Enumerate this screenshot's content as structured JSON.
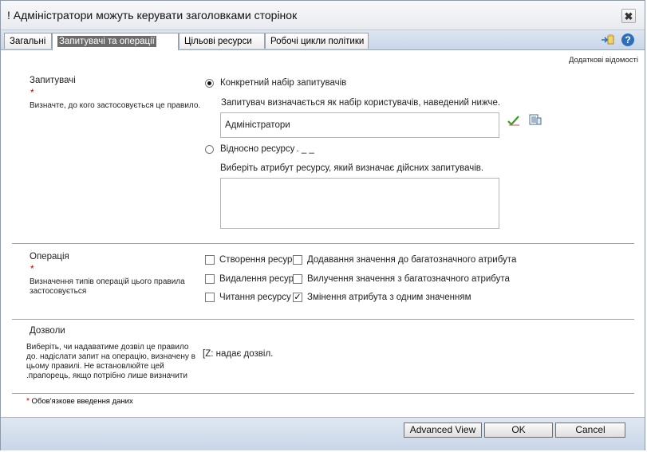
{
  "window": {
    "title": "! Адміністратори можуть керувати заголовками сторінок",
    "close_glyph": "✖"
  },
  "tabs": [
    {
      "label": "Загальні",
      "active": false
    },
    {
      "label": "Запитувачі та операції",
      "active": true
    },
    {
      "label": "Цільові ресурси",
      "active": false
    },
    {
      "label": "Робочі цикли політики",
      "active": false
    }
  ],
  "top_link": "Додаткові відомості",
  "requestors": {
    "title": "Запитувачі",
    "required_mark": "*",
    "description": "Визначте, до кого застосовується це правило.",
    "option_specific": "Конкретний набір запитувачів",
    "specific_help": "Запитувач визначається як набір користувачів, наведений нижче.",
    "specific_value": "Адміністратори",
    "option_relative": "Відносно ресурсу",
    "relative_suffix": ". _ _",
    "relative_help": "Виберіть атрибут ресурсу, який визначає дійсних запитувачів.",
    "relative_value": "",
    "selected": "specific"
  },
  "operation": {
    "title": "Операція",
    "required_mark": "*",
    "description": "Визначення типів операцій цього правила застосовується",
    "items": [
      {
        "label": "Створення ресурсу",
        "checked": false
      },
      {
        "label": "Додавання значення до багатозначного атрибута",
        "checked": false
      },
      {
        "label": "Видалення ресурсу",
        "checked": false
      },
      {
        "label": "Вилучення значення з багатозначного атрибута",
        "checked": false
      },
      {
        "label": "Читання ресурсу",
        "checked": false
      },
      {
        "label": "Змінення атрибута з одним значенням",
        "checked": true
      }
    ]
  },
  "permissions": {
    "title": "Дозволи",
    "description": "Виберіть, чи надаватиме дозвіл це правило до. надіслати запит на операцію, визначену в цьому правилі. Не встановлюйте цей .прапорець, якщо потрібно лише визначити",
    "checkbox_label": "[Z: надає дозвіл.",
    "checked": false
  },
  "required_note": {
    "mark": "*",
    "text": "Обов'язкове введення даних"
  },
  "buttons": {
    "advanced": "Advanced View",
    "ok": "OK",
    "cancel": "Cancel"
  },
  "icons": {
    "close": "close-icon",
    "add": "add-to-list-icon",
    "help": "help-icon",
    "validate": "check-name-icon",
    "browse": "browse-icon"
  },
  "colors": {
    "accent": "#2d6fb8",
    "required": "#c00000",
    "tab_selected": "#6c6c6c"
  }
}
